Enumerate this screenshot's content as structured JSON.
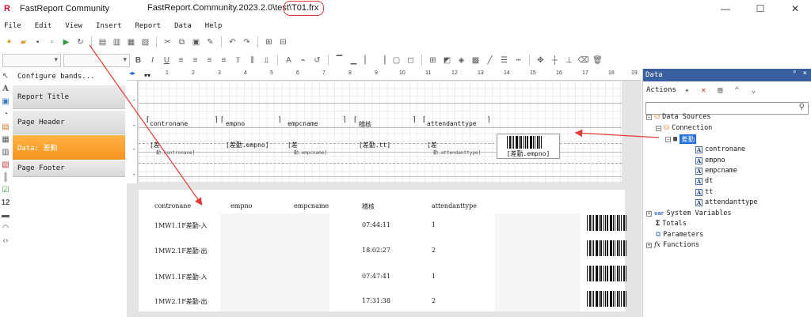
{
  "window": {
    "app_name": "FastReport Community",
    "doc_path": "FastReport.Community.2023.2.0\\test",
    "doc_file": "\\T01.frx",
    "buttons": {
      "minimize": "—",
      "maximize": "☐",
      "close": "✕"
    }
  },
  "menu": [
    "File",
    "Edit",
    "View",
    "Insert",
    "Report",
    "Data",
    "Help"
  ],
  "bands_panel": {
    "configure": "Configure bands...",
    "items": [
      {
        "label": "Report Title",
        "active": false
      },
      {
        "label": "Page Header",
        "active": false
      },
      {
        "label": "Data: 差勤",
        "active": true
      },
      {
        "label": "Page Footer",
        "active": false
      }
    ]
  },
  "ruler": [
    "1",
    "2",
    "3",
    "4",
    "5",
    "6",
    "7",
    "8",
    "9",
    "10",
    "11",
    "12",
    "13",
    "14",
    "15",
    "16",
    "17",
    "18",
    "19"
  ],
  "designer": {
    "header_cells": [
      "contronane",
      "empno",
      "empcname",
      "稽核",
      "attendanttype"
    ],
    "data_cells": [
      "[差",
      "[差勤.empno]",
      "[差",
      "[差勤.tt]",
      "[差"
    ],
    "data_cells_sub": [
      "勤.contronane]",
      "",
      "勤.empcname]",
      "",
      "勤.attendanttype]"
    ],
    "barcode_label": "[差勤.empno]"
  },
  "preview": {
    "headers": [
      "contronane",
      "empno",
      "empcname",
      "稽核",
      "attendanttype"
    ],
    "rows": [
      {
        "name": "1MW1.1F差勤-入",
        "time": "07:44:11",
        "type": "1"
      },
      {
        "name": "1MW2.1F差勤-出",
        "time": "18:02:27",
        "type": "2"
      },
      {
        "name": "1MW1.1F差勤-入",
        "time": "07:47:41",
        "type": "1"
      },
      {
        "name": "1MW2.1F差勤-出",
        "time": "17:31:38",
        "type": "2"
      }
    ]
  },
  "data_panel": {
    "title": "Data",
    "pin": "ᵖ",
    "close": "×",
    "actions_label": "Actions",
    "tree": {
      "data_sources": "Data Sources",
      "connection": "Connection",
      "table": "差勤",
      "fields": [
        "contronane",
        "empno",
        "empcname",
        "dt",
        "tt",
        "attendanttype"
      ],
      "system_variables": "System Variables",
      "totals": "Totals",
      "parameters": "Parameters",
      "functions": "Functions"
    }
  },
  "colors": {
    "accent_orange": "#f7941d",
    "title_blue": "#3a5f9e",
    "annotation_red": "#e53935",
    "selection_blue": "#1e6fd9"
  }
}
